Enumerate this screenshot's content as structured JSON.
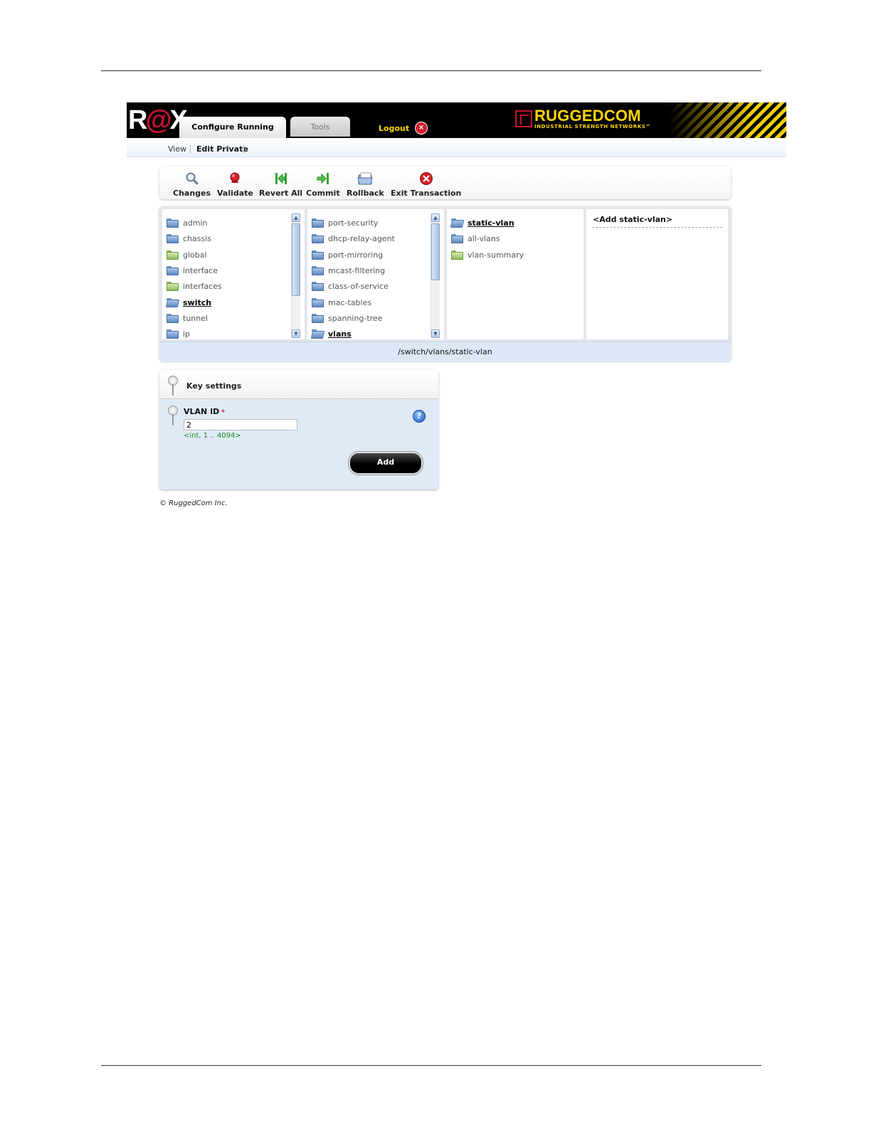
{
  "header": {
    "logo_text": "ROX",
    "tabs": [
      {
        "label": "Configure Running"
      },
      {
        "label": "Tools"
      }
    ],
    "logout_label": "Logout",
    "brand_name": "RUGGEDCOM",
    "brand_tagline": "INDUSTRIAL STRENGTH NETWORKS™"
  },
  "subnav": {
    "view_label": "View",
    "edit_private_label": "Edit Private"
  },
  "toolbar": {
    "buttons": [
      {
        "label": "Changes",
        "icon": "magnifier-icon"
      },
      {
        "label": "Validate",
        "icon": "validate-stamp-icon"
      },
      {
        "label": "Revert All",
        "icon": "revert-arrow-icon"
      },
      {
        "label": "Commit",
        "icon": "commit-arrow-icon"
      },
      {
        "label": "Rollback",
        "icon": "rollback-folder-icon"
      },
      {
        "label": "Exit Transaction",
        "icon": "exit-x-icon"
      }
    ]
  },
  "browser": {
    "column1": [
      {
        "label": "admin",
        "color": "blue"
      },
      {
        "label": "chassis",
        "color": "blue"
      },
      {
        "label": "global",
        "color": "green"
      },
      {
        "label": "interface",
        "color": "blue"
      },
      {
        "label": "interfaces",
        "color": "green"
      },
      {
        "label": "switch",
        "color": "blue",
        "selected": true
      },
      {
        "label": "tunnel",
        "color": "blue"
      },
      {
        "label": "ip",
        "color": "blue"
      }
    ],
    "column2": [
      {
        "label": "port-security",
        "color": "blue"
      },
      {
        "label": "dhcp-relay-agent",
        "color": "blue"
      },
      {
        "label": "port-mirroring",
        "color": "blue"
      },
      {
        "label": "mcast-filtering",
        "color": "blue"
      },
      {
        "label": "class-of-service",
        "color": "blue"
      },
      {
        "label": "mac-tables",
        "color": "blue"
      },
      {
        "label": "spanning-tree",
        "color": "blue"
      },
      {
        "label": "vlans",
        "color": "blue",
        "selected": true
      }
    ],
    "column3": [
      {
        "label": "static-vlan",
        "color": "blue",
        "selected": true
      },
      {
        "label": "all-vlans",
        "color": "blue"
      },
      {
        "label": "vlan-summary",
        "color": "green"
      }
    ],
    "column4_link": "<Add static-vlan>",
    "path": "/switch/vlans/static-vlan"
  },
  "key_settings": {
    "title": "Key settings",
    "field_label": "VLAN ID",
    "required_mark": "*",
    "value": "2",
    "hint": "<int, 1 .. 4094>",
    "help_label": "?",
    "add_label": "Add"
  },
  "footer": {
    "copyright": "© RuggedCom Inc."
  },
  "colors": {
    "header_bg": "#000000",
    "brand_yellow": "#ffd700",
    "panel_blue": "#dfeaf6",
    "hint_green": "#1c8c1c"
  }
}
